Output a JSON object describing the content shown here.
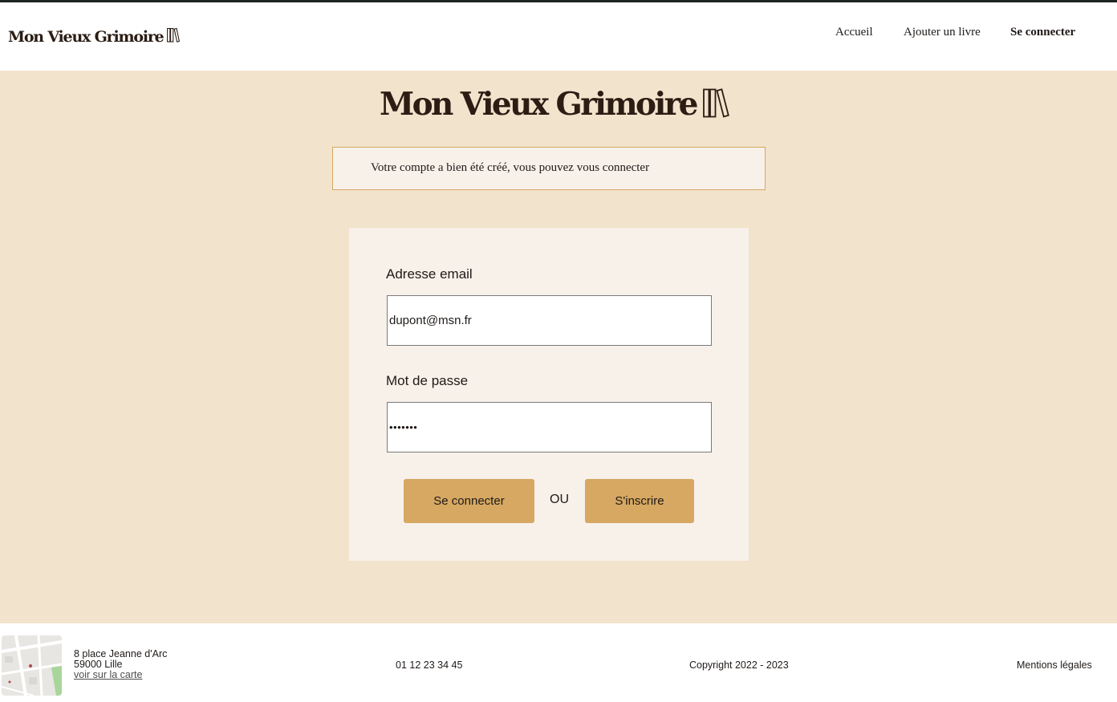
{
  "brand": {
    "name": "Mon Vieux Grimoire",
    "icon": "books-icon"
  },
  "nav": {
    "home": "Accueil",
    "add_book": "Ajouter un livre",
    "login": "Se connecter"
  },
  "notice": {
    "message": "Votre compte a bien été créé, vous pouvez vous connecter"
  },
  "form": {
    "email_label": "Adresse email",
    "email_value": "dupont@msn.fr",
    "password_label": "Mot de passe",
    "password_value": "•••••••",
    "login_button": "Se connecter",
    "or_label": "OU",
    "signup_button": "S'inscrire"
  },
  "footer": {
    "map_icon": "map-thumbnail",
    "address_line1": "8 place Jeanne d'Arc",
    "address_line2": "59000 Lille",
    "map_link": "voir sur la carte",
    "phone": "01 12 23 34 45",
    "copyright": "Copyright 2022 - 2023",
    "legal": "Mentions légales"
  },
  "colors": {
    "page_background": "#f2e3cc",
    "card_background": "#f7f1ea",
    "accent": "#d6a862",
    "brand_text": "#2b1d14",
    "top_bar": "#1e2421"
  }
}
